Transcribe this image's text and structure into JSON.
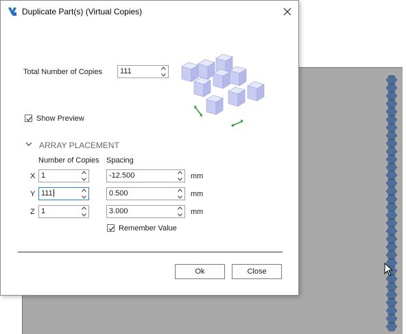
{
  "dialog": {
    "title": "Duplicate Part(s) (Virtual Copies)",
    "total_copies_label": "Total Number of Copies",
    "total_copies_value": "111",
    "show_preview_label": "Show Preview",
    "show_preview_checked": true,
    "section_title": "ARRAY PLACEMENT",
    "columns": {
      "copies": "Number of Copies",
      "spacing": "Spacing"
    },
    "rows": [
      {
        "axis": "X",
        "copies": "1",
        "spacing": "-12.500",
        "unit": "mm"
      },
      {
        "axis": "Y",
        "copies": "111",
        "spacing": "0.500",
        "unit": "mm"
      },
      {
        "axis": "Z",
        "copies": "1",
        "spacing": "3.000",
        "unit": "mm"
      }
    ],
    "remember_label": "Remember Value",
    "remember_checked": true,
    "ok_label": "Ok",
    "close_label": "Close"
  },
  "colors": {
    "accent": "#2c7fd3",
    "cube_face": "#c9cdf2",
    "arrow_green": "#2f9a3a",
    "viewport": "#a9a9a9",
    "hex_fill": "#4f6f99"
  },
  "icons": [
    "app-icon",
    "close-icon",
    "chevron-down-icon",
    "spin-up-icon",
    "spin-down-icon",
    "checkmark-icon",
    "cube-array-illustration",
    "mouse-cursor-icon"
  ]
}
